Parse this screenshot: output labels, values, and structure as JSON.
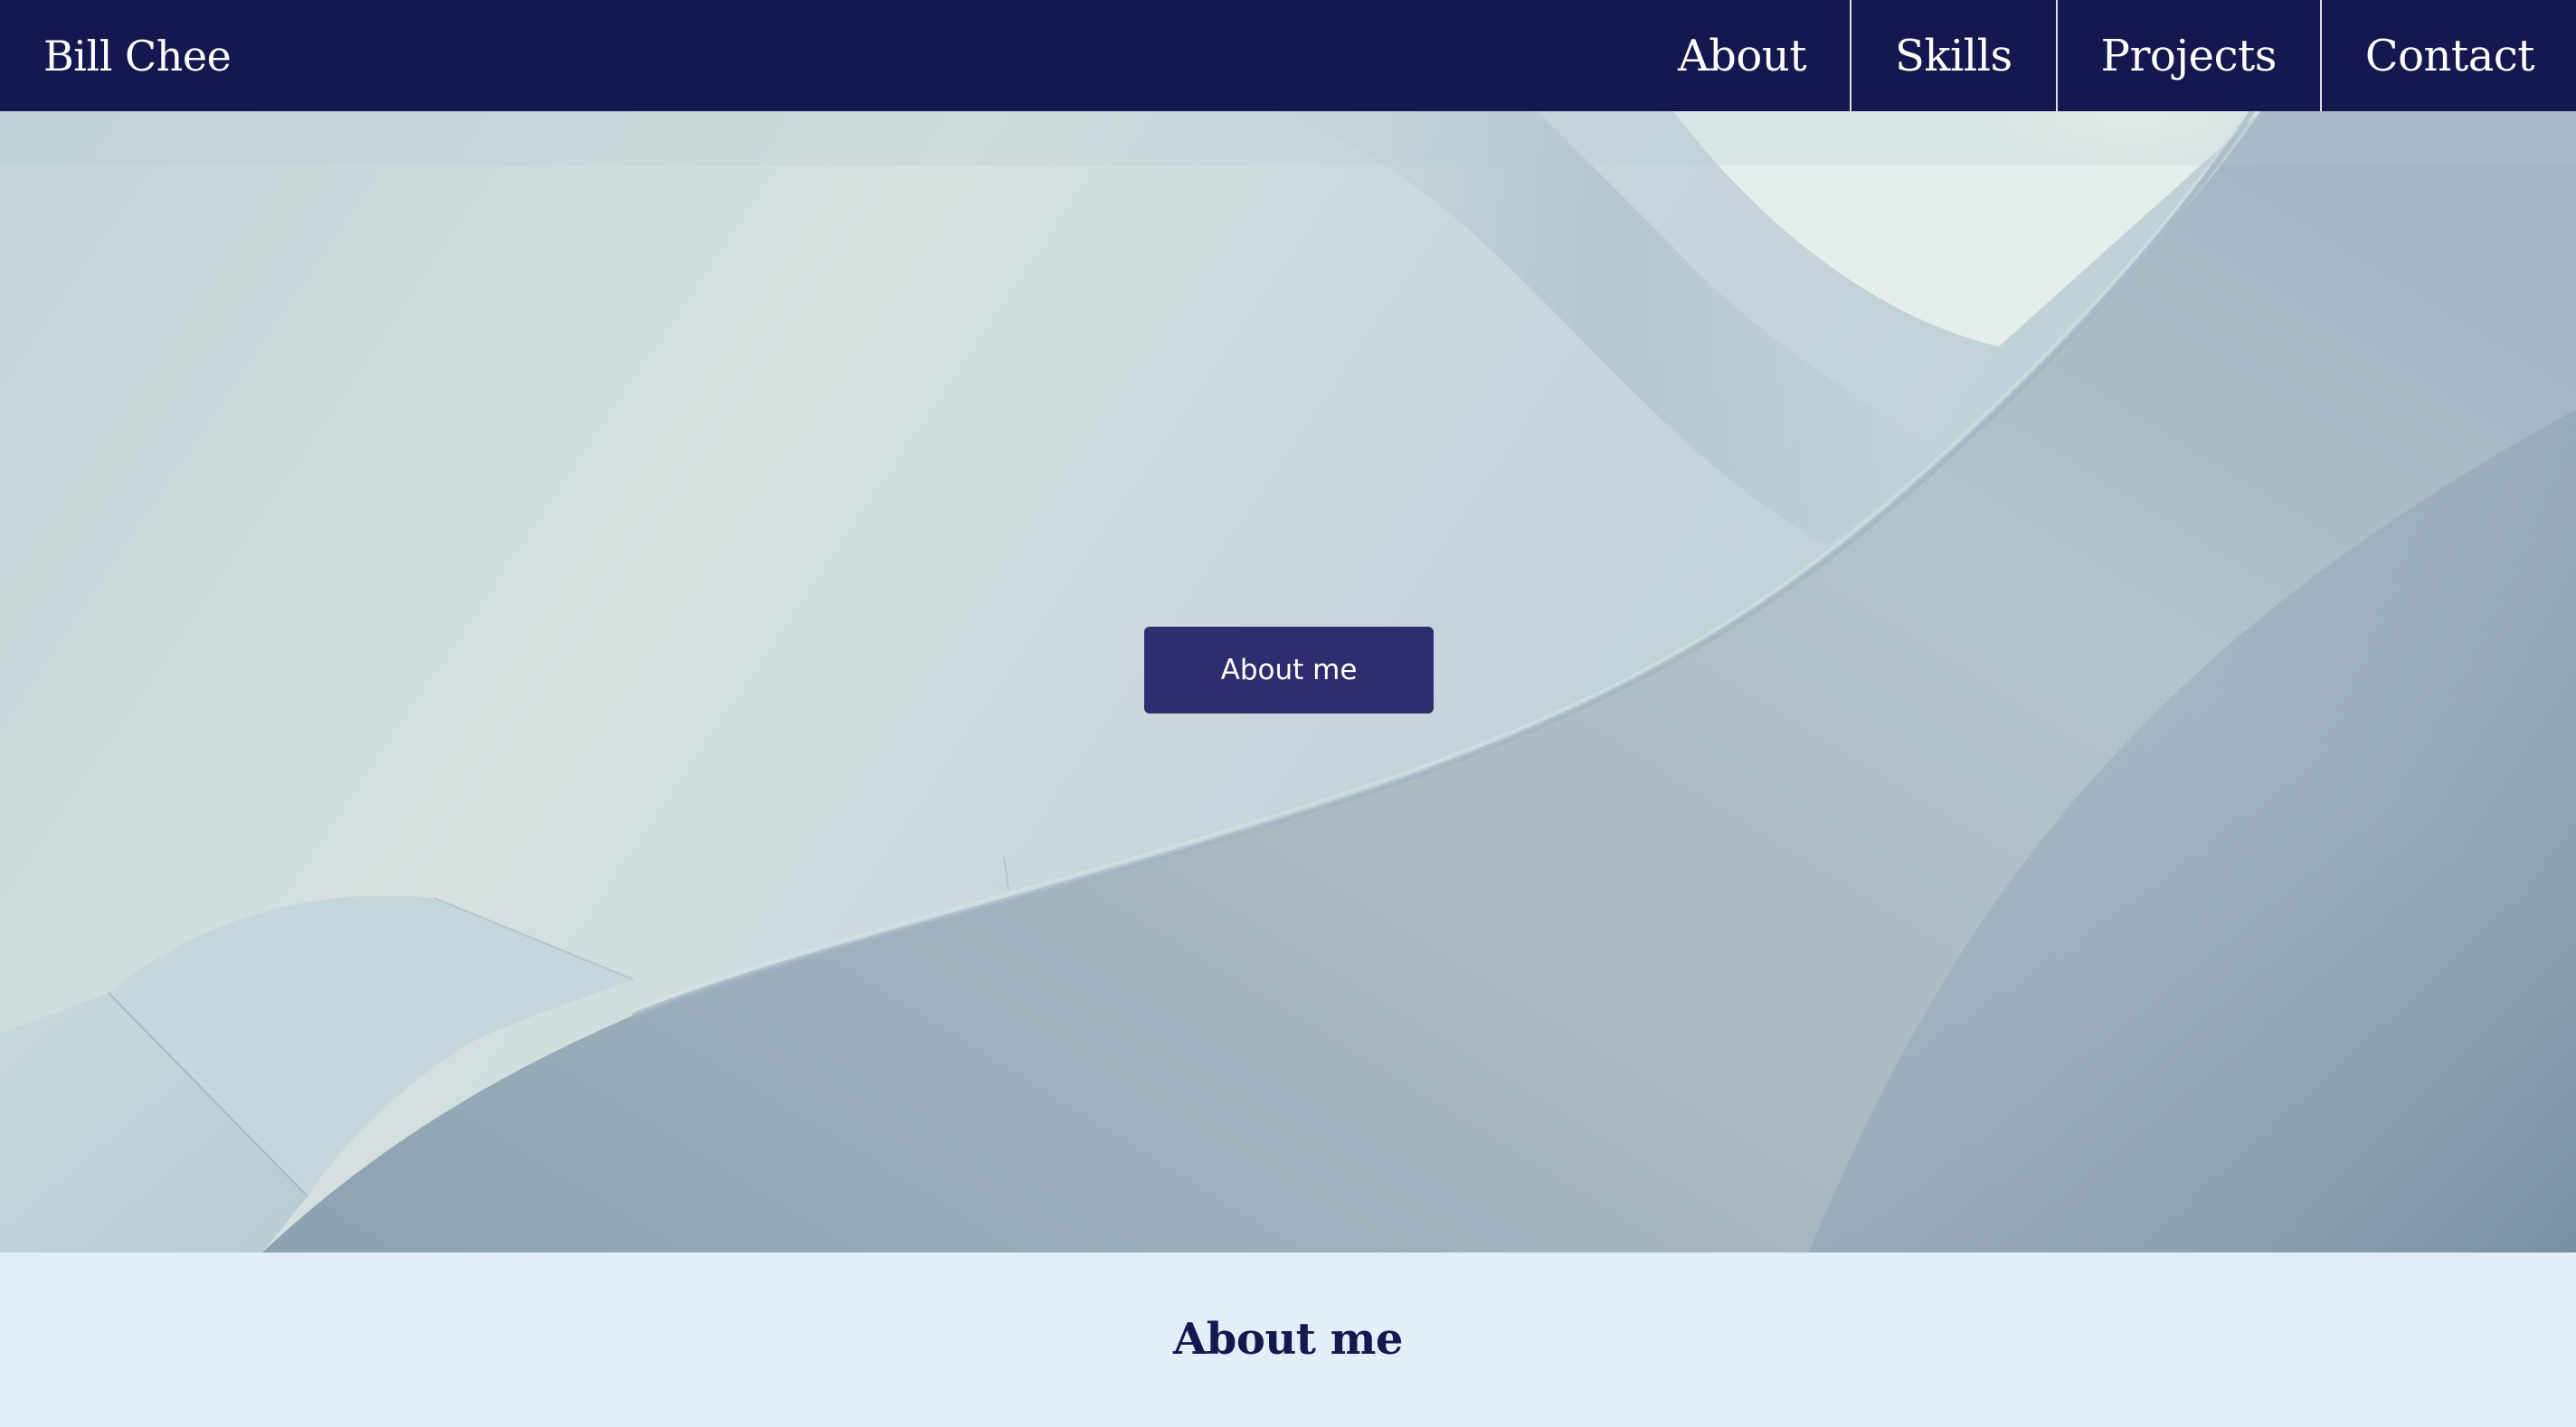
{
  "navbar": {
    "brand": "Bill Chee",
    "links": [
      {
        "label": "About"
      },
      {
        "label": "Skills"
      },
      {
        "label": "Projects"
      },
      {
        "label": "Contact"
      }
    ]
  },
  "hero": {
    "button_label": "About me"
  },
  "about": {
    "heading": "About me"
  },
  "colors": {
    "navbar_bg": "#15174f",
    "button_bg": "#2e2d6f",
    "section_bg": "#e0eff8",
    "heading_color": "#15174f"
  }
}
